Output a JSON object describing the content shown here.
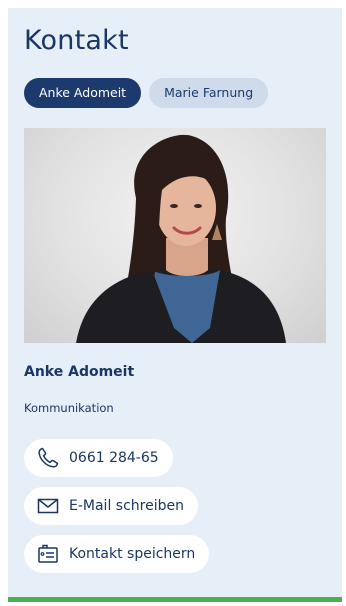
{
  "contact_card": {
    "title": "Kontakt",
    "tabs": [
      {
        "label": "Anke Adomeit",
        "active": true
      },
      {
        "label": "Marie Farnung",
        "active": false
      }
    ],
    "person": {
      "name": "Anke Adomeit",
      "role": "Kommunikation"
    },
    "actions": {
      "phone": {
        "label": "0661 284-65",
        "icon": "phone-icon"
      },
      "email": {
        "label": "E-Mail schreiben",
        "icon": "envelope-icon"
      },
      "save": {
        "label": "Kontakt speichern",
        "icon": "contact-card-icon"
      }
    }
  },
  "colors": {
    "card_background": "#e6eef8",
    "primary_navy": "#1c3a6e",
    "tab_inactive": "#cfdbea",
    "accent_green": "#4caf50"
  }
}
